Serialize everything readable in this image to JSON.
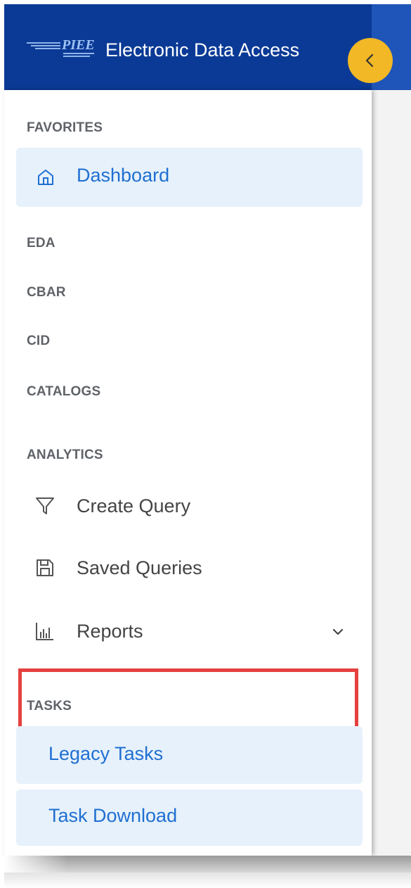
{
  "header": {
    "logo_text": "PIEE",
    "title": "Electronic Data Access"
  },
  "colors": {
    "header_bg": "#0b3a96",
    "accent_yellow": "#f2b825",
    "active_pill_bg": "#e6f1fb",
    "active_text": "#1f6fd1",
    "highlight_border": "#e5413f"
  },
  "sidebar": {
    "favorites_label": "FAVORITES",
    "dashboard_label": "Dashboard",
    "eda_label": "EDA",
    "cbar_label": "CBAR",
    "cid_label": "CID",
    "catalogs_label": "CATALOGS",
    "analytics_label": "ANALYTICS",
    "create_query_label": "Create Query",
    "saved_queries_label": "Saved Queries",
    "reports_label": "Reports",
    "tasks_label": "TASKS",
    "legacy_tasks_label": "Legacy Tasks",
    "task_download_label": "Task Download"
  },
  "icons": {
    "collapse": "chevron-left-icon",
    "dashboard": "home-icon",
    "create_query": "filter-icon",
    "saved_queries": "save-icon",
    "reports": "bar-chart-icon",
    "reports_expand": "chevron-down-icon"
  }
}
